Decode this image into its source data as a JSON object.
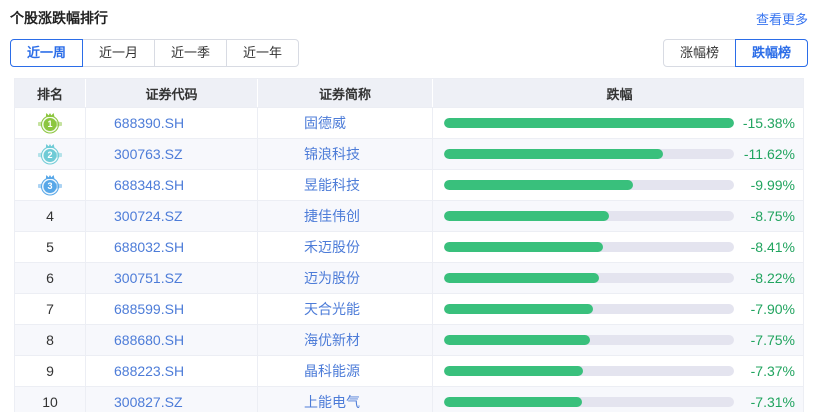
{
  "header": {
    "title": "个股涨跌幅排行",
    "more_link": "查看更多"
  },
  "filters": {
    "periods": [
      {
        "label": "近一周",
        "selected": true
      },
      {
        "label": "近一月",
        "selected": false
      },
      {
        "label": "近一季",
        "selected": false
      },
      {
        "label": "近一年",
        "selected": false
      }
    ],
    "boards": [
      {
        "label": "涨幅榜",
        "selected": false
      },
      {
        "label": "跌幅榜",
        "selected": true
      }
    ]
  },
  "table": {
    "columns": [
      "排名",
      "证券代码",
      "证券简称",
      "跌幅"
    ],
    "rows": [
      {
        "rank": "1",
        "code": "688390.SH",
        "name": "固德威",
        "pct": "-15.38%",
        "drop": 15.38
      },
      {
        "rank": "2",
        "code": "300763.SZ",
        "name": "锦浪科技",
        "pct": "-11.62%",
        "drop": 11.62
      },
      {
        "rank": "3",
        "code": "688348.SH",
        "name": "昱能科技",
        "pct": "-9.99%",
        "drop": 9.99
      },
      {
        "rank": "4",
        "code": "300724.SZ",
        "name": "捷佳伟创",
        "pct": "-8.75%",
        "drop": 8.75
      },
      {
        "rank": "5",
        "code": "688032.SH",
        "name": "禾迈股份",
        "pct": "-8.41%",
        "drop": 8.41
      },
      {
        "rank": "6",
        "code": "300751.SZ",
        "name": "迈为股份",
        "pct": "-8.22%",
        "drop": 8.22
      },
      {
        "rank": "7",
        "code": "688599.SH",
        "name": "天合光能",
        "pct": "-7.90%",
        "drop": 7.9
      },
      {
        "rank": "8",
        "code": "688680.SH",
        "name": "海优新材",
        "pct": "-7.75%",
        "drop": 7.75
      },
      {
        "rank": "9",
        "code": "688223.SH",
        "name": "晶科能源",
        "pct": "-7.37%",
        "drop": 7.37
      },
      {
        "rank": "10",
        "code": "300827.SZ",
        "name": "上能电气",
        "pct": "-7.31%",
        "drop": 7.31
      }
    ]
  },
  "icons": {
    "rank1": "gold-medal-badge",
    "rank2": "silver-medal-badge",
    "rank3": "bronze-medal-badge"
  },
  "colors": {
    "accent": "#2b6de8",
    "link": "#3875f0",
    "code_text": "#4d7cd8",
    "pct_green": "#21a45f",
    "bar_fill": "#39c07c",
    "bar_track": "#e4e4ef",
    "medal_gold": "#8cc63f",
    "medal_silver": "#6fcbd6",
    "medal_bronze": "#57a7e8"
  }
}
